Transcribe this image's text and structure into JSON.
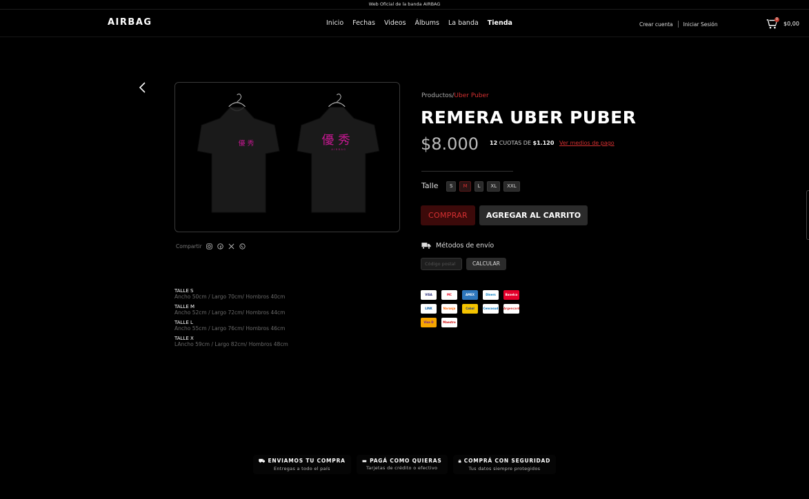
{
  "topbar": {
    "text": "Web Oficial de la banda AIRBAG"
  },
  "header": {
    "logo": "AIRBAG",
    "nav": [
      "Inicio",
      "Fechas",
      "Videos",
      "Álbums",
      "La banda",
      "Tienda"
    ],
    "active_nav": "Tienda",
    "create_account": "Crear cuenta",
    "login": "Iniciar Sesión",
    "cart_count": "0",
    "cart_total": "$0,00"
  },
  "product": {
    "breadcrumb_root": "Productos",
    "breadcrumb_sep": "/",
    "breadcrumb_current": "Uber Puber",
    "title": "REMERA UBER PUBER",
    "price": "$8.000",
    "installments_count": "12",
    "installments_text": "CUOTAS DE",
    "installments_amount": "$1.120",
    "payment_link": "Ver medios de pago",
    "size_label": "Talle",
    "sizes": [
      "S",
      "M",
      "L",
      "XL",
      "XXL"
    ],
    "selected_size": "M",
    "buy_button": "COMPRAR",
    "add_to_cart_button": "AGREGAR AL CARRITO",
    "shipping_label": "Métodos de envío",
    "postal_placeholder": "Código postal",
    "calculate_button": "CALCULAR",
    "share_label": "Compartir"
  },
  "size_guide": [
    {
      "name": "TALLE S",
      "dims": "Ancho 50cm / Largo 70cm/ Hombros 40cm"
    },
    {
      "name": "TALLE M",
      "dims": "Ancho 52cm / Largo 72cm/ Hombros 44cm"
    },
    {
      "name": "TALLE L",
      "dims": "Ancho 55cm / Largo 76cm/ Hombros 46cm"
    },
    {
      "name": "TALLE X",
      "dims": "LAncho 59cm / Largo 82cm/ Hombros 48cm"
    }
  ],
  "payment_methods": [
    {
      "name": "VISA",
      "bg": "#ffffff",
      "fg": "#1a1f71"
    },
    {
      "name": "MC",
      "bg": "#ffffff",
      "fg": "#eb001b"
    },
    {
      "name": "AMEX",
      "bg": "#2e77bc",
      "fg": "#ffffff"
    },
    {
      "name": "Diners",
      "bg": "#ffffff",
      "fg": "#0079be"
    },
    {
      "name": "Banelco",
      "bg": "#e4002b",
      "fg": "#ffffff"
    },
    {
      "name": "LINK",
      "bg": "#ffffff",
      "fg": "#005aa7"
    },
    {
      "name": "Naranja",
      "bg": "#ffffff",
      "fg": "#ff6200"
    },
    {
      "name": "Cabal",
      "bg": "#f5c400",
      "fg": "#1d3b8a"
    },
    {
      "name": "Cencosud",
      "bg": "#ffffff",
      "fg": "#0072bc"
    },
    {
      "name": "Argencard",
      "bg": "#ffffff",
      "fg": "#d32f2f"
    },
    {
      "name": "Visa D",
      "bg": "#f7a600",
      "fg": "#6a1b9a"
    },
    {
      "name": "Maestro",
      "bg": "#ffffff",
      "fg": "#cc0000"
    }
  ],
  "benefits": [
    {
      "title": "ENVIAMOS TU COMPRA",
      "sub": "Entregas a todo el país",
      "icon": "truck-icon"
    },
    {
      "title": "PAGÁ COMO QUIERAS",
      "sub": "Tarjetas de crédito o efectivo",
      "icon": "card-icon"
    },
    {
      "title": "COMPRÁ CON SEGURIDAD",
      "sub": "Tus datos siempre protegidos",
      "icon": "lock-icon"
    }
  ],
  "colors": {
    "accent": "#d63031",
    "background": "#000000",
    "print_pink": "#c2188f"
  }
}
